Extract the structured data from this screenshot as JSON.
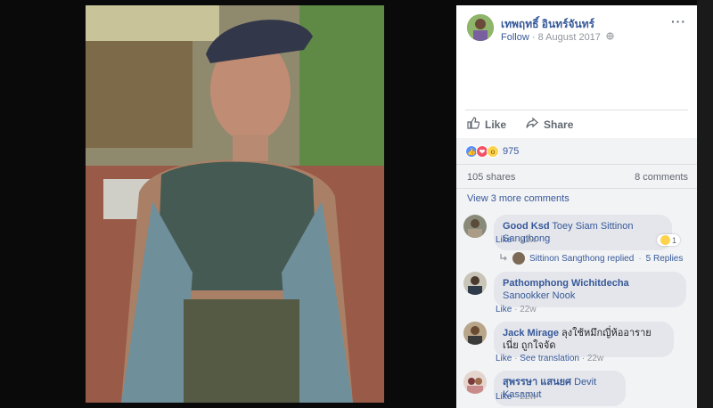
{
  "post": {
    "author": "เทพฤทธิ์ อินทร์จันทร์",
    "follow_label": "Follow",
    "separator": " · ",
    "date": "8 August 2017",
    "privacy_icon": "globe-icon",
    "more_icon": "more-options-icon"
  },
  "actions": {
    "like_label": "Like",
    "share_label": "Share"
  },
  "reactions": {
    "count": "975",
    "types": [
      "like",
      "love",
      "wow"
    ]
  },
  "stats": {
    "shares": "105 shares",
    "comments": "8 comments"
  },
  "view_more": "View 3 more comments",
  "comments": [
    {
      "name": "Good Ksd",
      "text": "Toey Siam Sittinon Sangthong",
      "like": "Like",
      "time": "22w",
      "reaction_count": "1",
      "reply_summary": "Sittinon Sangthong replied",
      "reply_count": "5 Replies"
    },
    {
      "name": "Pathomphong Wichitdecha",
      "text": "Sanookker Nook",
      "like": "Like",
      "time": "22w"
    },
    {
      "name": "Jack Mirage",
      "text": "ลุงใช้หมึกญี่ห้ออารายเนี่ย ถูกใจจัด",
      "like": "Like",
      "see_translation": "See translation",
      "time": "22w"
    },
    {
      "name": "สุพรรษา แสนยศ",
      "text": "Devit Kasamut",
      "like": "Like",
      "time": "22w"
    }
  ],
  "colors": {
    "link": "#365899",
    "muted": "#90949c",
    "bubble": "#e4e6eb",
    "panel_bg": "#f2f3f5"
  }
}
